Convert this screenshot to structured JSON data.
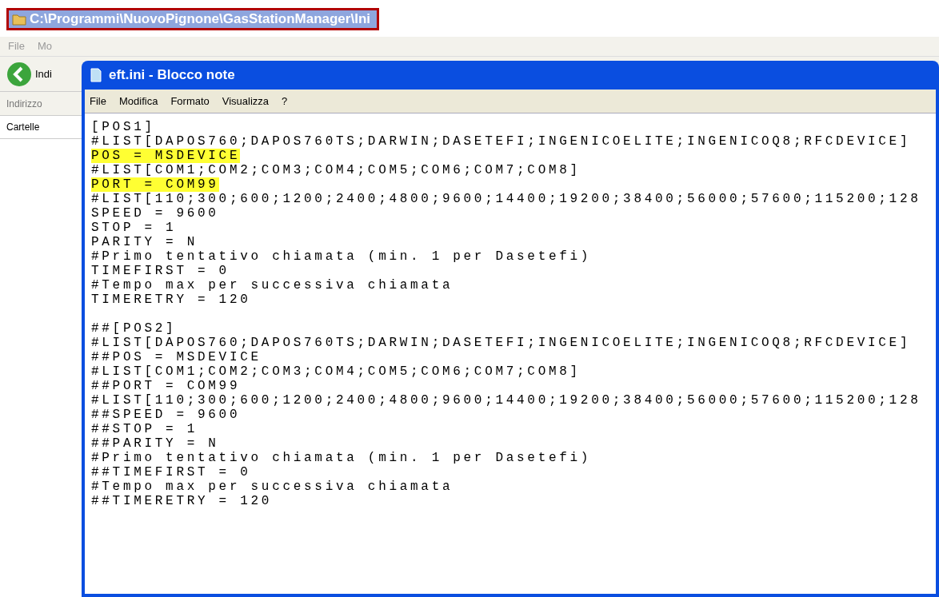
{
  "explorer": {
    "title": "C:\\Programmi\\NuovoPignone\\GasStationManager\\Ini",
    "title_outlined": true,
    "menu": [
      "File",
      "Mo"
    ],
    "back_label": "Indi",
    "address_label": "Indirizzo",
    "folders_label": "Cartelle"
  },
  "notepad": {
    "title": "eft.ini - Blocco note",
    "menu": [
      "File",
      "Modifica",
      "Formato",
      "Visualizza",
      "?"
    ],
    "lines": [
      {
        "kind": "text",
        "text": "[POS1]",
        "highlighted": false
      },
      {
        "kind": "text",
        "text": "#LIST[DAPOS760;DAPOS760TS;DARWIN;DASETEFI;INGENICOELITE;INGENICOQ8;RFCDEVICE]",
        "highlighted": false
      },
      {
        "kind": "text",
        "text": "POS = MSDEVICE",
        "highlighted": true
      },
      {
        "kind": "text",
        "text": "#LIST[COM1;COM2;COM3;COM4;COM5;COM6;COM7;COM8]",
        "highlighted": false
      },
      {
        "kind": "text",
        "text": "PORT = COM99",
        "highlighted": true
      },
      {
        "kind": "text",
        "text": "#LIST[110;300;600;1200;2400;4800;9600;14400;19200;38400;56000;57600;115200;128",
        "highlighted": false
      },
      {
        "kind": "text",
        "text": "SPEED = 9600",
        "highlighted": false
      },
      {
        "kind": "text",
        "text": "STOP = 1",
        "highlighted": false
      },
      {
        "kind": "text",
        "text": "PARITY = N",
        "highlighted": false
      },
      {
        "kind": "text",
        "text": "#Primo tentativo chiamata (min. 1 per Dasetefi)",
        "highlighted": false
      },
      {
        "kind": "text",
        "text": "TIMEFIRST = 0",
        "highlighted": false
      },
      {
        "kind": "text",
        "text": "#Tempo max per successiva chiamata",
        "highlighted": false
      },
      {
        "kind": "text",
        "text": "TIMERETRY = 120",
        "highlighted": false
      },
      {
        "kind": "blank"
      },
      {
        "kind": "text",
        "text": "##[POS2]",
        "highlighted": false
      },
      {
        "kind": "text",
        "text": "#LIST[DAPOS760;DAPOS760TS;DARWIN;DASETEFI;INGENICOELITE;INGENICOQ8;RFCDEVICE]",
        "highlighted": false
      },
      {
        "kind": "text",
        "text": "##POS = MSDEVICE",
        "highlighted": false
      },
      {
        "kind": "text",
        "text": "#LIST[COM1;COM2;COM3;COM4;COM5;COM6;COM7;COM8]",
        "highlighted": false
      },
      {
        "kind": "text",
        "text": "##PORT = COM99",
        "highlighted": false
      },
      {
        "kind": "text",
        "text": "#LIST[110;300;600;1200;2400;4800;9600;14400;19200;38400;56000;57600;115200;128",
        "highlighted": false
      },
      {
        "kind": "text",
        "text": "##SPEED = 9600",
        "highlighted": false
      },
      {
        "kind": "text",
        "text": "##STOP = 1",
        "highlighted": false
      },
      {
        "kind": "text",
        "text": "##PARITY = N",
        "highlighted": false
      },
      {
        "kind": "text",
        "text": "#Primo tentativo chiamata (min. 1 per Dasetefi)",
        "highlighted": false
      },
      {
        "kind": "text",
        "text": "##TIMEFIRST = 0",
        "highlighted": false
      },
      {
        "kind": "text",
        "text": "#Tempo max per successiva chiamata",
        "highlighted": false
      },
      {
        "kind": "text",
        "text": "##TIMERETRY = 120",
        "highlighted": false
      }
    ]
  }
}
